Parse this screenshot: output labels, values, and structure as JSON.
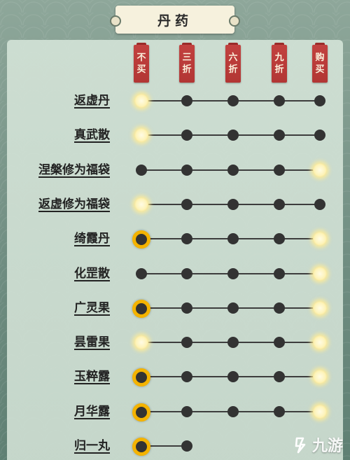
{
  "title": "丹药",
  "columns": [
    {
      "line1": "不",
      "line2": "买"
    },
    {
      "line1": "三",
      "line2": "折"
    },
    {
      "line1": "六",
      "line2": "折"
    },
    {
      "line1": "九",
      "line2": "折"
    },
    {
      "line1": "购",
      "line2": "买"
    }
  ],
  "rows": [
    {
      "label": "返虚丹",
      "states": [
        "glow",
        "dot",
        "dot",
        "dot",
        "dot"
      ]
    },
    {
      "label": "真武散",
      "states": [
        "glow",
        "dot",
        "dot",
        "dot",
        "dot"
      ]
    },
    {
      "label": "涅槃修为福袋",
      "states": [
        "dot",
        "dot",
        "dot",
        "dot",
        "glow"
      ]
    },
    {
      "label": "返虚修为福袋",
      "states": [
        "glow",
        "dot",
        "dot",
        "dot",
        "dot"
      ]
    },
    {
      "label": "绮霞丹",
      "states": [
        "ring",
        "dot",
        "dot",
        "dot",
        "glow"
      ]
    },
    {
      "label": "化罡散",
      "states": [
        "dot",
        "dot",
        "dot",
        "dot",
        "glow"
      ]
    },
    {
      "label": "广灵果",
      "states": [
        "ring",
        "dot",
        "dot",
        "dot",
        "glow"
      ]
    },
    {
      "label": "昙雷果",
      "states": [
        "glow",
        "dot",
        "dot",
        "dot",
        "glow"
      ]
    },
    {
      "label": "玉粹露",
      "states": [
        "ring",
        "dot",
        "dot",
        "dot",
        "glow"
      ]
    },
    {
      "label": "月华露",
      "states": [
        "ring",
        "dot",
        "dot",
        "dot",
        "glow"
      ]
    },
    {
      "label": "归一丸",
      "states": [
        "ring",
        "dot"
      ]
    }
  ],
  "watermark": {
    "text": "九游",
    "icon": "nine-game-logo-icon"
  },
  "colors": {
    "tag": "#b93a38",
    "ring": "#f4b300",
    "glow": "#fdf3b8",
    "dot": "#333333"
  }
}
